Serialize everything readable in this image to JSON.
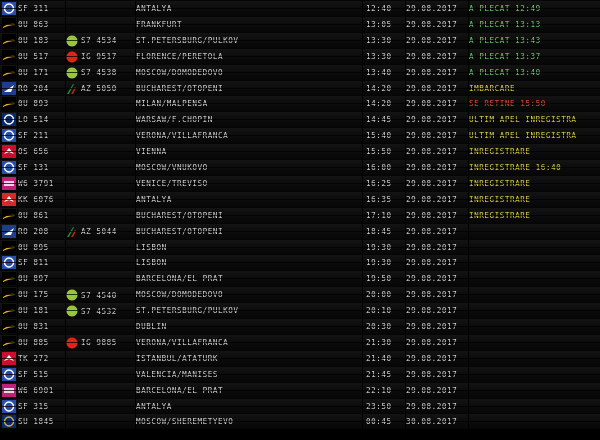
{
  "title": "",
  "rows": [
    {
      "airline": "SF",
      "code": "SF 311",
      "partner_logo": "",
      "partner_code": "",
      "destination": "ANTALYA",
      "time": "12:40",
      "date": "29.08.2017",
      "status": "A PLECAT 12:49",
      "status_color": "#6fd06a",
      "logo_bg": "#2a4fa8",
      "logo_fg": "#ffffff"
    },
    {
      "airline": "0U",
      "code": "0U 863",
      "partner_logo": "",
      "partner_code": "",
      "destination": "FRANKFURT",
      "time": "13:05",
      "date": "29.08.2017",
      "status": "A PLECAT 13:13",
      "status_color": "#6fd06a",
      "logo_bg": "#000000",
      "logo_fg": "#f0c020"
    },
    {
      "airline": "0U",
      "code": "0U 183",
      "partner_logo": "s7-logo",
      "partner_code": "S7 4534",
      "destination": "ST.PETERSBURG/PULKOV",
      "time": "13:30",
      "date": "29.08.2017",
      "status": "A PLECAT 13:43",
      "status_color": "#6fd06a",
      "logo_bg": "#000000",
      "logo_fg": "#f0c020"
    },
    {
      "airline": "0U",
      "code": "0U 517",
      "partner_logo": "alitalia-red-logo",
      "partner_code": "IG 9517",
      "destination": "FLORENCE/PERETOLA",
      "time": "13:30",
      "date": "29.08.2017",
      "status": "A PLECAT 13:37",
      "status_color": "#6fd06a",
      "logo_bg": "#000000",
      "logo_fg": "#f0c020"
    },
    {
      "airline": "0U",
      "code": "0U 171",
      "partner_logo": "s7-logo",
      "partner_code": "S7 4538",
      "destination": "MOSCOW/DOMODEDOVO",
      "time": "13:40",
      "date": "29.08.2017",
      "status": "A PLECAT 13:40",
      "status_color": "#6fd06a",
      "logo_bg": "#000000",
      "logo_fg": "#f0c020"
    },
    {
      "airline": "RO",
      "code": "RO 204",
      "partner_logo": "alitalia-logo",
      "partner_code": "AZ 5050",
      "destination": "BUCHAREST/OTOPENI",
      "time": "14:20",
      "date": "29.08.2017",
      "status": "IMBARCARE",
      "status_color": "#e0d44a",
      "logo_bg": "#1c3f8a",
      "logo_fg": "#ffffff"
    },
    {
      "airline": "0U",
      "code": "0U 893",
      "partner_logo": "",
      "partner_code": "",
      "destination": "MILAN/MALPENSA",
      "time": "14:20",
      "date": "29.08.2017",
      "status": "SE RETINE 15:50",
      "status_color": "#e04a3a",
      "logo_bg": "#000000",
      "logo_fg": "#f0c020"
    },
    {
      "airline": "LO",
      "code": "LO 514",
      "partner_logo": "",
      "partner_code": "",
      "destination": "WARSAW/F.CHOPIN",
      "time": "14:45",
      "date": "29.08.2017",
      "status": "ULTIM APEL INREGISTRA",
      "status_color": "#e0d44a",
      "logo_bg": "#0a2a6a",
      "logo_fg": "#ffffff"
    },
    {
      "airline": "SF",
      "code": "SF 211",
      "partner_logo": "",
      "partner_code": "",
      "destination": "VERONA/VILLAFRANCA",
      "time": "15:40",
      "date": "29.08.2017",
      "status": "ULTIM APEL INREGISTRA",
      "status_color": "#e0d44a",
      "logo_bg": "#2a4fa8",
      "logo_fg": "#ffffff"
    },
    {
      "airline": "OS",
      "code": "OS 656",
      "partner_logo": "",
      "partner_code": "",
      "destination": "VIENNA",
      "time": "15:50",
      "date": "29.08.2017",
      "status": "INREGISTRARE",
      "status_color": "#e0d44a",
      "logo_bg": "#c8102e",
      "logo_fg": "#ffffff"
    },
    {
      "airline": "SF",
      "code": "SF 131",
      "partner_logo": "",
      "partner_code": "",
      "destination": "MOSCOW/VNUKOVO",
      "time": "16:00",
      "date": "29.08.2017",
      "status": "INREGISTRARE 16:40",
      "status_color": "#e0d44a",
      "logo_bg": "#2a4fa8",
      "logo_fg": "#ffffff"
    },
    {
      "airline": "W6",
      "code": "W6 3791",
      "partner_logo": "",
      "partner_code": "",
      "destination": "VENICE/TREVISO",
      "time": "16:25",
      "date": "29.08.2017",
      "status": "INREGISTRARE",
      "status_color": "#e0d44a",
      "logo_bg": "#c21f7a",
      "logo_fg": "#ffffff"
    },
    {
      "airline": "KK",
      "code": "KK 6076",
      "partner_logo": "",
      "partner_code": "",
      "destination": "ANTALYA",
      "time": "16:35",
      "date": "29.08.2017",
      "status": "INREGISTRARE",
      "status_color": "#e0d44a",
      "logo_bg": "#d42a2a",
      "logo_fg": "#ffffff"
    },
    {
      "airline": "0U",
      "code": "0U 861",
      "partner_logo": "",
      "partner_code": "",
      "destination": "BUCHAREST/OTOPENI",
      "time": "17:10",
      "date": "29.08.2017",
      "status": "INREGISTRARE",
      "status_color": "#e0d44a",
      "logo_bg": "#000000",
      "logo_fg": "#f0c020"
    },
    {
      "airline": "RO",
      "code": "RO 208",
      "partner_logo": "alitalia-logo",
      "partner_code": "AZ 5044",
      "destination": "BUCHAREST/OTOPENI",
      "time": "18:45",
      "date": "29.08.2017",
      "status": "",
      "status_color": "#e0d44a",
      "logo_bg": "#1c3f8a",
      "logo_fg": "#ffffff"
    },
    {
      "airline": "0U",
      "code": "0U 895",
      "partner_logo": "",
      "partner_code": "",
      "destination": "LISBON",
      "time": "19:30",
      "date": "29.08.2017",
      "status": "",
      "status_color": "#e0d44a",
      "logo_bg": "#000000",
      "logo_fg": "#f0c020"
    },
    {
      "airline": "SF",
      "code": "SF 811",
      "partner_logo": "",
      "partner_code": "",
      "destination": "LISBON",
      "time": "19:30",
      "date": "29.08.2017",
      "status": "",
      "status_color": "#e0d44a",
      "logo_bg": "#2a4fa8",
      "logo_fg": "#ffffff"
    },
    {
      "airline": "0U",
      "code": "0U 897",
      "partner_logo": "",
      "partner_code": "",
      "destination": "BARCELONA/EL PRAT",
      "time": "19:50",
      "date": "29.08.2017",
      "status": "",
      "status_color": "#e0d44a",
      "logo_bg": "#000000",
      "logo_fg": "#f0c020"
    },
    {
      "airline": "0U",
      "code": "0U 175",
      "partner_logo": "s7-logo",
      "partner_code": "S7 4540",
      "destination": "MOSCOW/DOMODEDOVO",
      "time": "20:00",
      "date": "29.08.2017",
      "status": "",
      "status_color": "#e0d44a",
      "logo_bg": "#000000",
      "logo_fg": "#f0c020"
    },
    {
      "airline": "0U",
      "code": "0U 181",
      "partner_logo": "s7-logo",
      "partner_code": "S7 4532",
      "destination": "ST.PETERSBURG/PULKOV",
      "time": "20:10",
      "date": "29.08.2017",
      "status": "",
      "status_color": "#e0d44a",
      "logo_bg": "#000000",
      "logo_fg": "#f0c020"
    },
    {
      "airline": "0U",
      "code": "0U 831",
      "partner_logo": "",
      "partner_code": "",
      "destination": "DUBLIN",
      "time": "20:30",
      "date": "29.08.2017",
      "status": "",
      "status_color": "#e0d44a",
      "logo_bg": "#000000",
      "logo_fg": "#f0c020"
    },
    {
      "airline": "0U",
      "code": "0U 885",
      "partner_logo": "alitalia-red-logo",
      "partner_code": "IG 9885",
      "destination": "VERONA/VILLAFRANCA",
      "time": "21:30",
      "date": "29.08.2017",
      "status": "",
      "status_color": "#e0d44a",
      "logo_bg": "#000000",
      "logo_fg": "#f0c020"
    },
    {
      "airline": "TK",
      "code": "TK 272",
      "partner_logo": "",
      "partner_code": "",
      "destination": "ISTANBUL/ATATURK",
      "time": "21:40",
      "date": "29.08.2017",
      "status": "",
      "status_color": "#e0d44a",
      "logo_bg": "#c8102e",
      "logo_fg": "#ffffff"
    },
    {
      "airline": "SF",
      "code": "SF 515",
      "partner_logo": "",
      "partner_code": "",
      "destination": "VALENCIA/MANISES",
      "time": "21:45",
      "date": "29.08.2017",
      "status": "",
      "status_color": "#e0d44a",
      "logo_bg": "#2a4fa8",
      "logo_fg": "#ffffff"
    },
    {
      "airline": "W6",
      "code": "W6 6901",
      "partner_logo": "",
      "partner_code": "",
      "destination": "BARCELONA/EL PRAT",
      "time": "22:10",
      "date": "29.08.2017",
      "status": "",
      "status_color": "#e0d44a",
      "logo_bg": "#c21f7a",
      "logo_fg": "#ffffff"
    },
    {
      "airline": "SF",
      "code": "SF 315",
      "partner_logo": "",
      "partner_code": "",
      "destination": "ANTALYA",
      "time": "23:50",
      "date": "29.08.2017",
      "status": "",
      "status_color": "#e0d44a",
      "logo_bg": "#2a4fa8",
      "logo_fg": "#ffffff"
    },
    {
      "airline": "SU",
      "code": "SU 1845",
      "partner_logo": "",
      "partner_code": "",
      "destination": "MOSCOW/SHEREMETYEVO",
      "time": "00:45",
      "date": "30.08.2017",
      "status": "",
      "status_color": "#e0d44a",
      "logo_bg": "#0b2a6b",
      "logo_fg": "#d7a93a"
    }
  ]
}
